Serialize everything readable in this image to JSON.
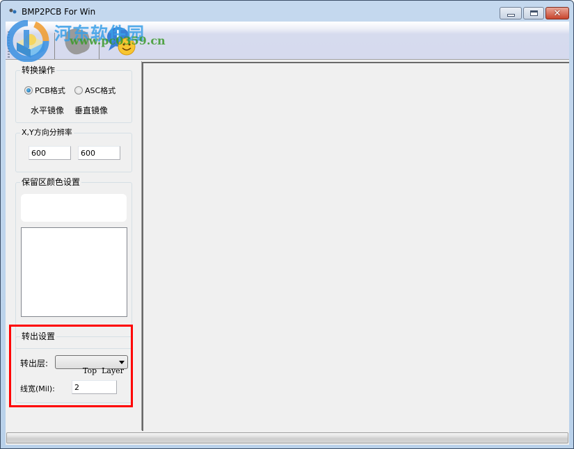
{
  "window": {
    "title": "BMP2PCB For Win",
    "controls": {
      "minimize": "minimize",
      "maximize": "maximize",
      "close": "✕"
    }
  },
  "toolbar": {
    "buttons": [
      {
        "icon": "open-file-icon"
      },
      {
        "icon": "image-icon"
      },
      {
        "icon": "help-chat-icon"
      }
    ]
  },
  "watermark": {
    "text": "河东软件园",
    "url": "www.pc0359.cn"
  },
  "convert_ops": {
    "title": "转换操作",
    "format_options": [
      {
        "label": "PCB格式",
        "checked": true
      },
      {
        "label": "ASC格式",
        "checked": false
      }
    ],
    "mirror_h": "水平镜像",
    "mirror_v": "垂直镜像"
  },
  "resolution": {
    "title": "X,Y方向分辨率",
    "x_value": "600",
    "y_value": "600"
  },
  "reserve_color": {
    "title": "保留区颜色设置"
  },
  "output": {
    "title": "转出设置",
    "layer_label": "转出层:",
    "layer_value": "Top  Layer",
    "width_label": "线宽(Mil):",
    "width_value": "2"
  },
  "colors": {
    "highlight": "#ff0000",
    "close_button": "#c8442c"
  }
}
